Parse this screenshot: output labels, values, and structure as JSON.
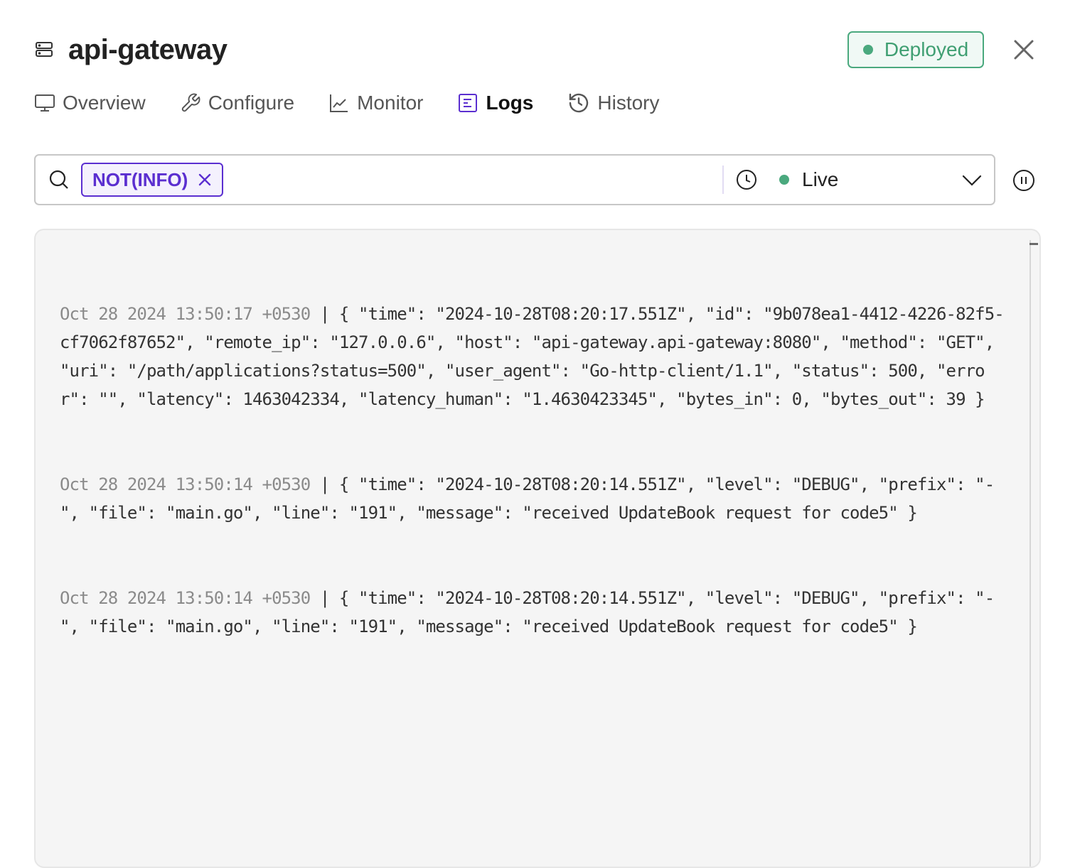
{
  "header": {
    "title": "api-gateway",
    "status_badge": "Deployed",
    "status_color": "#4aa97e"
  },
  "tabs": [
    {
      "label": "Overview",
      "icon": "monitor-icon",
      "active": false
    },
    {
      "label": "Configure",
      "icon": "wrench-icon",
      "active": false
    },
    {
      "label": "Monitor",
      "icon": "line-chart-icon",
      "active": false
    },
    {
      "label": "Logs",
      "icon": "logs-icon",
      "active": true
    },
    {
      "label": "History",
      "icon": "history-icon",
      "active": false
    }
  ],
  "filter": {
    "chips": [
      {
        "label": "NOT(INFO)"
      }
    ],
    "input_value": "",
    "input_placeholder": "",
    "time_range": "Live",
    "accent_color": "#5b2fd0"
  },
  "logs": [
    {
      "timestamp": "Oct 28 2024 13:50:17 +0530",
      "message": " | { \"time\": \"2024-10-28T08:20:17.551Z\", \"id\": \"9b078ea1-4412-4226-82f5-cf7062f87652\", \"remote_ip\": \"127.0.0.6\", \"host\": \"api-gateway.api-gateway:8080\", \"method\": \"GET\", \"uri\": \"/path/applications?status=500\", \"user_agent\": \"Go-http-client/1.1\", \"status\": 500, \"error\": \"\", \"latency\": 1463042334, \"latency_human\": \"1.4630423345\", \"bytes_in\": 0, \"bytes_out\": 39 }"
    },
    {
      "timestamp": "Oct 28 2024 13:50:14 +0530",
      "message": " | { \"time\": \"2024-10-28T08:20:14.551Z\", \"level\": \"DEBUG\", \"prefix\": \"-\", \"file\": \"main.go\", \"line\": \"191\", \"message\": \"received UpdateBook request for code5\" }"
    },
    {
      "timestamp": "Oct 28 2024 13:50:14 +0530",
      "message": " | { \"time\": \"2024-10-28T08:20:14.551Z\", \"level\": \"DEBUG\", \"prefix\": \"-\", \"file\": \"main.go\", \"line\": \"191\", \"message\": \"received UpdateBook request for code5\" }"
    }
  ]
}
